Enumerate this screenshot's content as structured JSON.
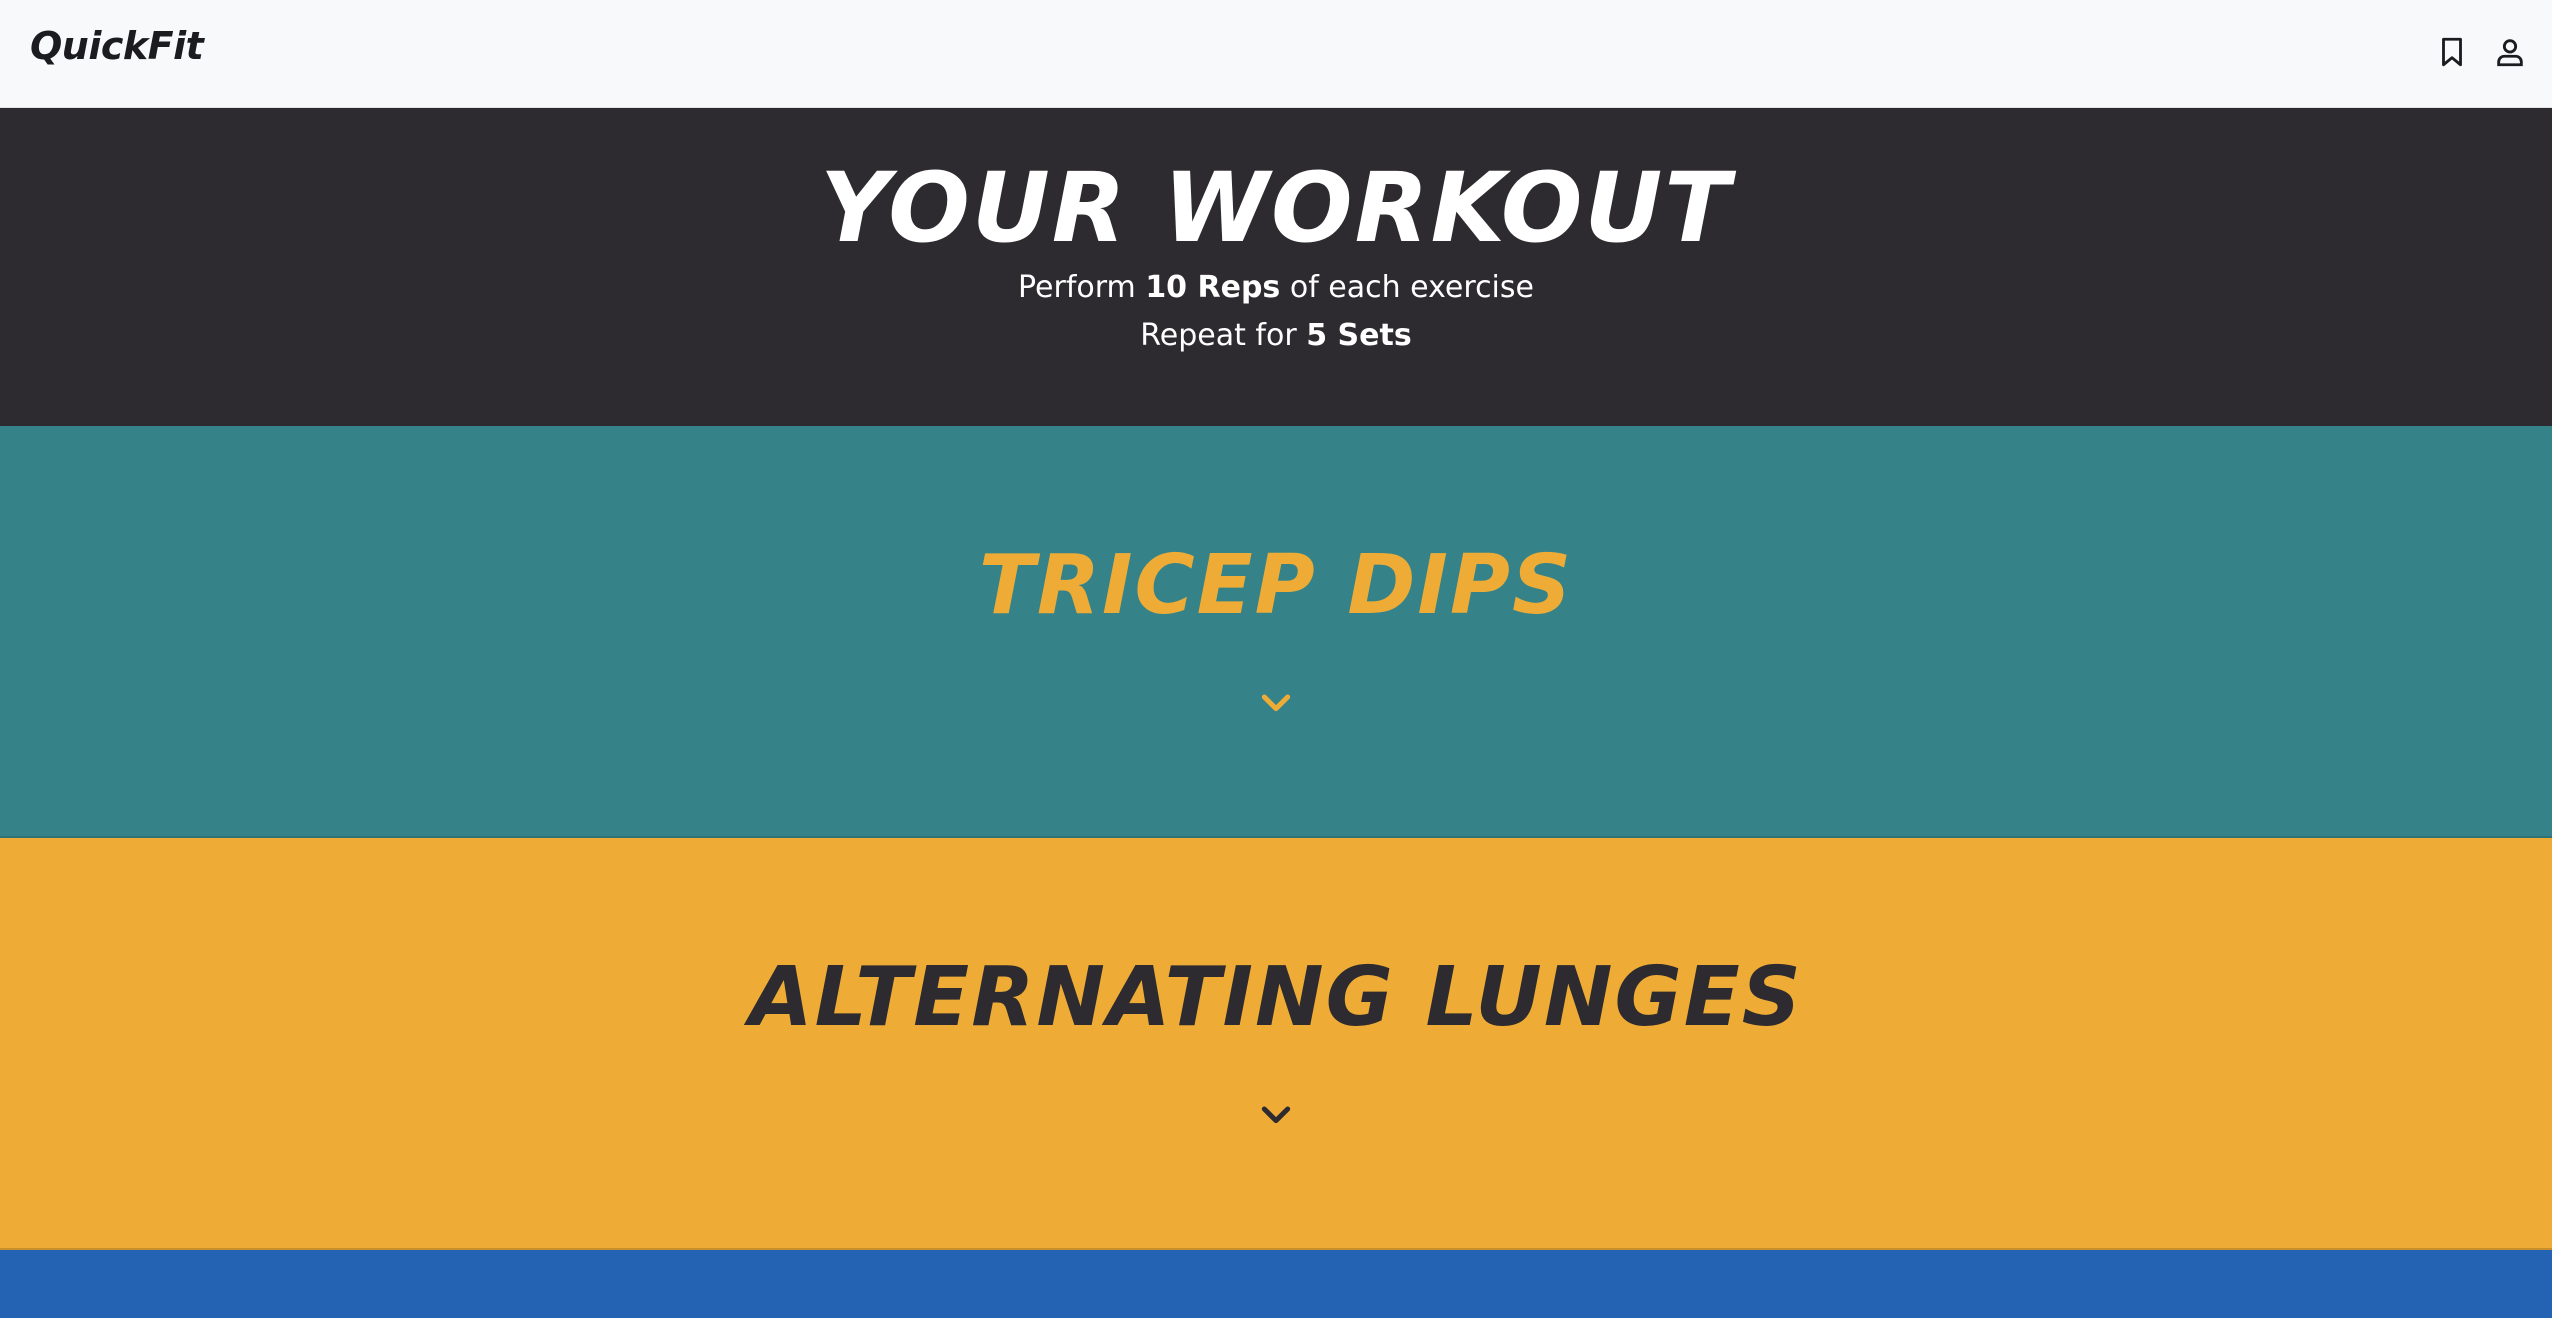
{
  "nav": {
    "brand": "QuickFit",
    "icons": [
      "bookmark-icon",
      "user-icon"
    ]
  },
  "hero": {
    "title": "YOUR WORKOUT",
    "line1": {
      "prefix": "Perform ",
      "bold": "10 Reps",
      "suffix": " of each exercise"
    },
    "line2": {
      "prefix": "Repeat for ",
      "bold": "5 Sets",
      "suffix": ""
    }
  },
  "exercises": [
    {
      "name": "TRICEP DIPS",
      "background": "#358389",
      "text_color": "#eeac36",
      "icon": "chevron-down-icon"
    },
    {
      "name": "ALTERNATING LUNGES",
      "background": "#eeac36",
      "text_color": "#2d2b2f",
      "icon": "chevron-down-icon"
    },
    {
      "name": "",
      "background": "#2463b3",
      "text_color": "#ffffff",
      "icon": "chevron-down-icon"
    }
  ],
  "colors": {
    "navbar_bg": "#f8f9fa",
    "hero_bg": "#2d2b2f",
    "teal": "#358389",
    "amber": "#eeac36",
    "blue": "#2463b3"
  }
}
